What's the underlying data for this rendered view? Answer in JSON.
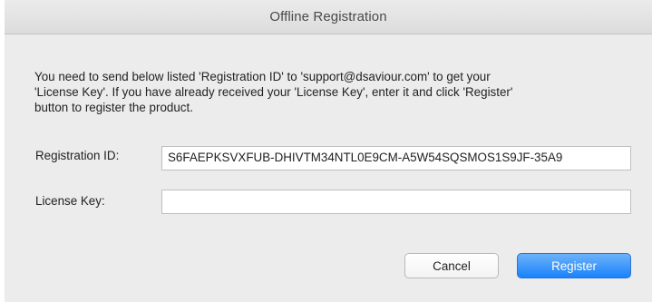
{
  "window": {
    "title": "Offline Registration"
  },
  "message": {
    "lines": [
      "You need to send below listed 'Registration ID' to 'support@dsaviour.com' to get your",
      "'License Key'. If you have already received your 'License Key', enter it and click 'Register'",
      "button to register the product."
    ]
  },
  "form": {
    "registration_id_label": "Registration ID:",
    "registration_id_value": "S6FAEPKSVXFUB-DHIVTM34NTL0E9CM-A5W54SQSMOS1S9JF-35A9",
    "license_key_label": "License Key:",
    "license_key_value": ""
  },
  "buttons": {
    "cancel_label": "Cancel",
    "register_label": "Register"
  },
  "colors": {
    "accent": "#1a82fb",
    "window_bg": "#ececec"
  }
}
